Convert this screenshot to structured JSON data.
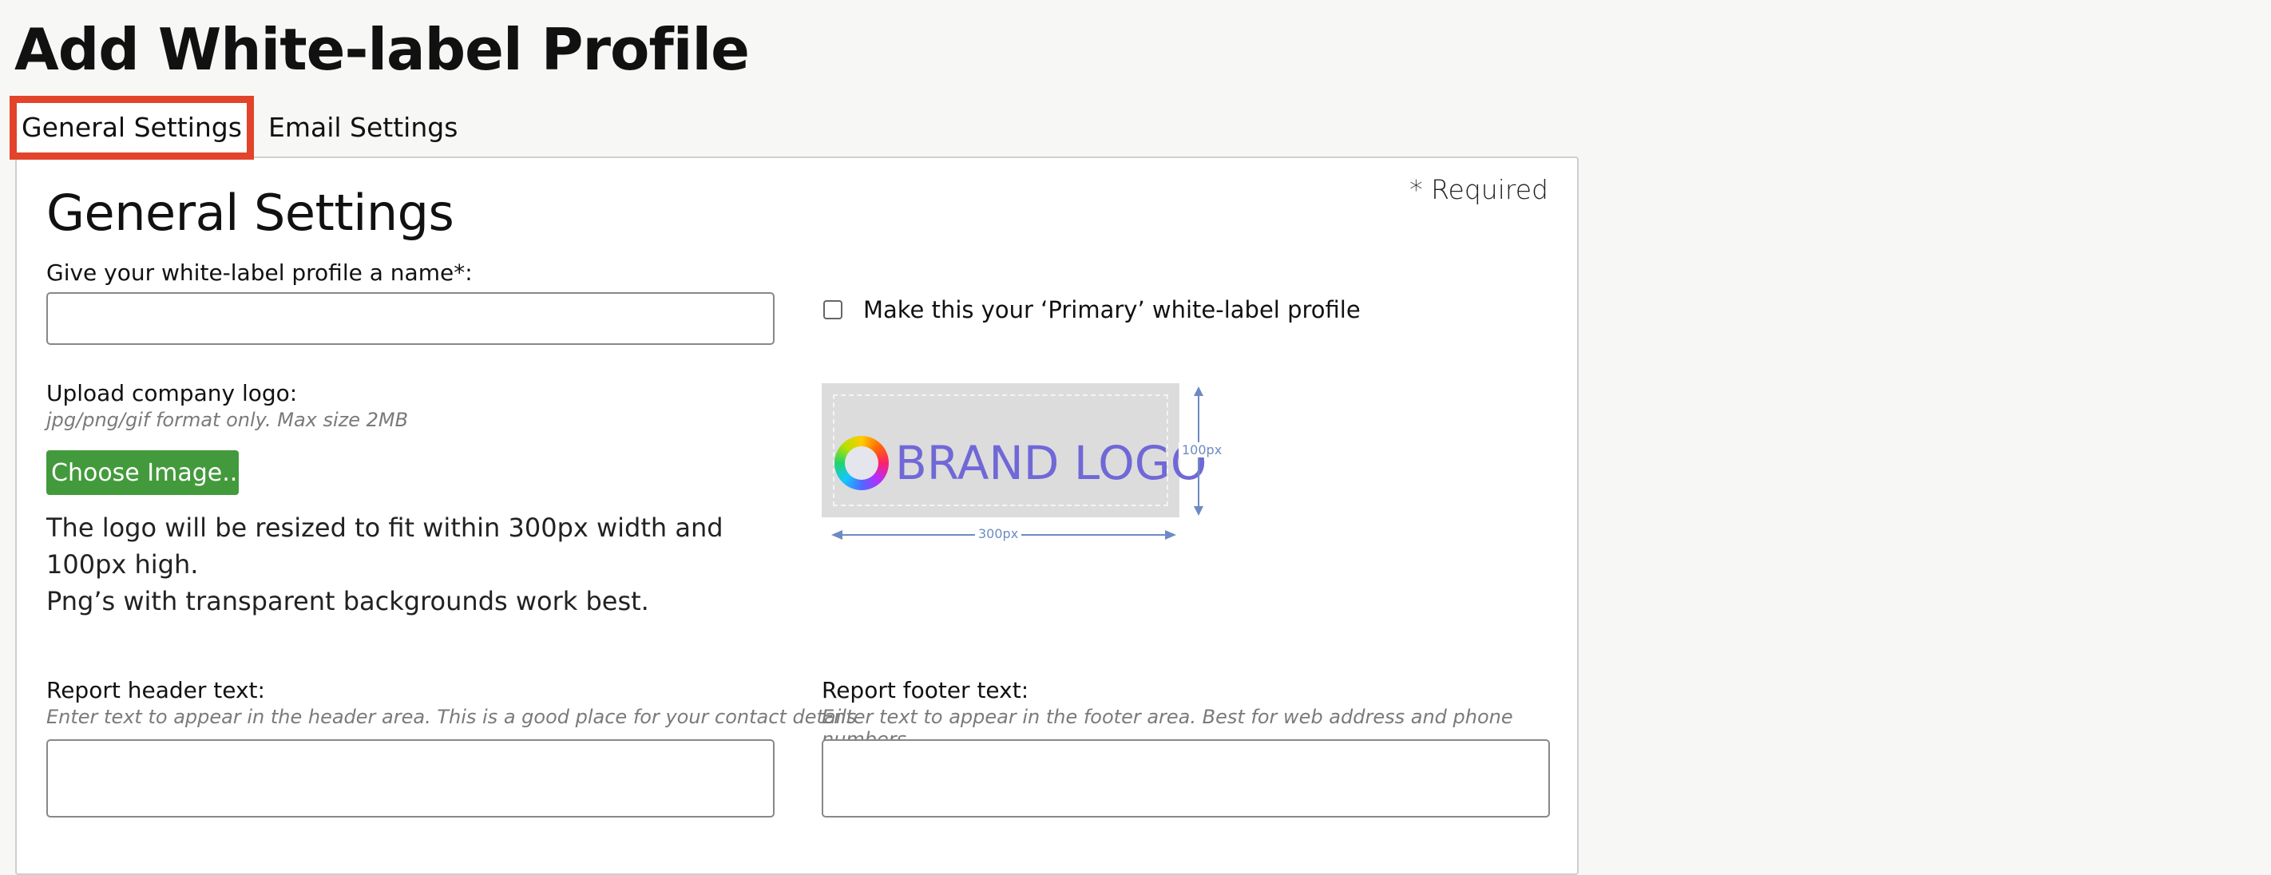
{
  "page": {
    "title": "Add White-label Profile"
  },
  "tabs": [
    {
      "label": "General Settings",
      "selected": true
    },
    {
      "label": "Email Settings",
      "selected": false
    }
  ],
  "general_settings": {
    "section_title": "General Settings",
    "required_note": "* Required",
    "profile_name_label": "Give your white-label profile a name*:",
    "profile_name_value": "",
    "primary_checkbox_label": "Make this your ‘Primary’ white-label profile",
    "primary_checked": false,
    "logo_upload_label": "Upload company logo:",
    "logo_upload_hint": "jpg/png/gif format only. Max size 2MB",
    "choose_image_label": "Choose Image...",
    "logo_note_line1": "The logo will be resized to fit within 300px width and 100px high.",
    "logo_note_line2": "Png’s with transparent backgrounds work best.",
    "logo_preview_text": "BRAND LOGO",
    "logo_preview_width_label": "300px",
    "logo_preview_height_label": "100px",
    "report_header_label": "Report header text:",
    "report_header_hint": "Enter text to appear in the header area. This is a good place for your contact details",
    "report_header_value": "",
    "report_footer_label": "Report footer text:",
    "report_footer_hint": "Enter text to appear in the footer area. Best for web address and phone numbers",
    "report_footer_value": ""
  },
  "colors": {
    "selected_tab_outline": "#e2432a",
    "choose_button": "#439a3c",
    "logo_text": "#7068d7",
    "dimension_marker": "#6d8bc2"
  },
  "icons": {
    "logo_mark": "colorful-ring-icon",
    "dimension_arrows": "double-arrow-icon"
  }
}
